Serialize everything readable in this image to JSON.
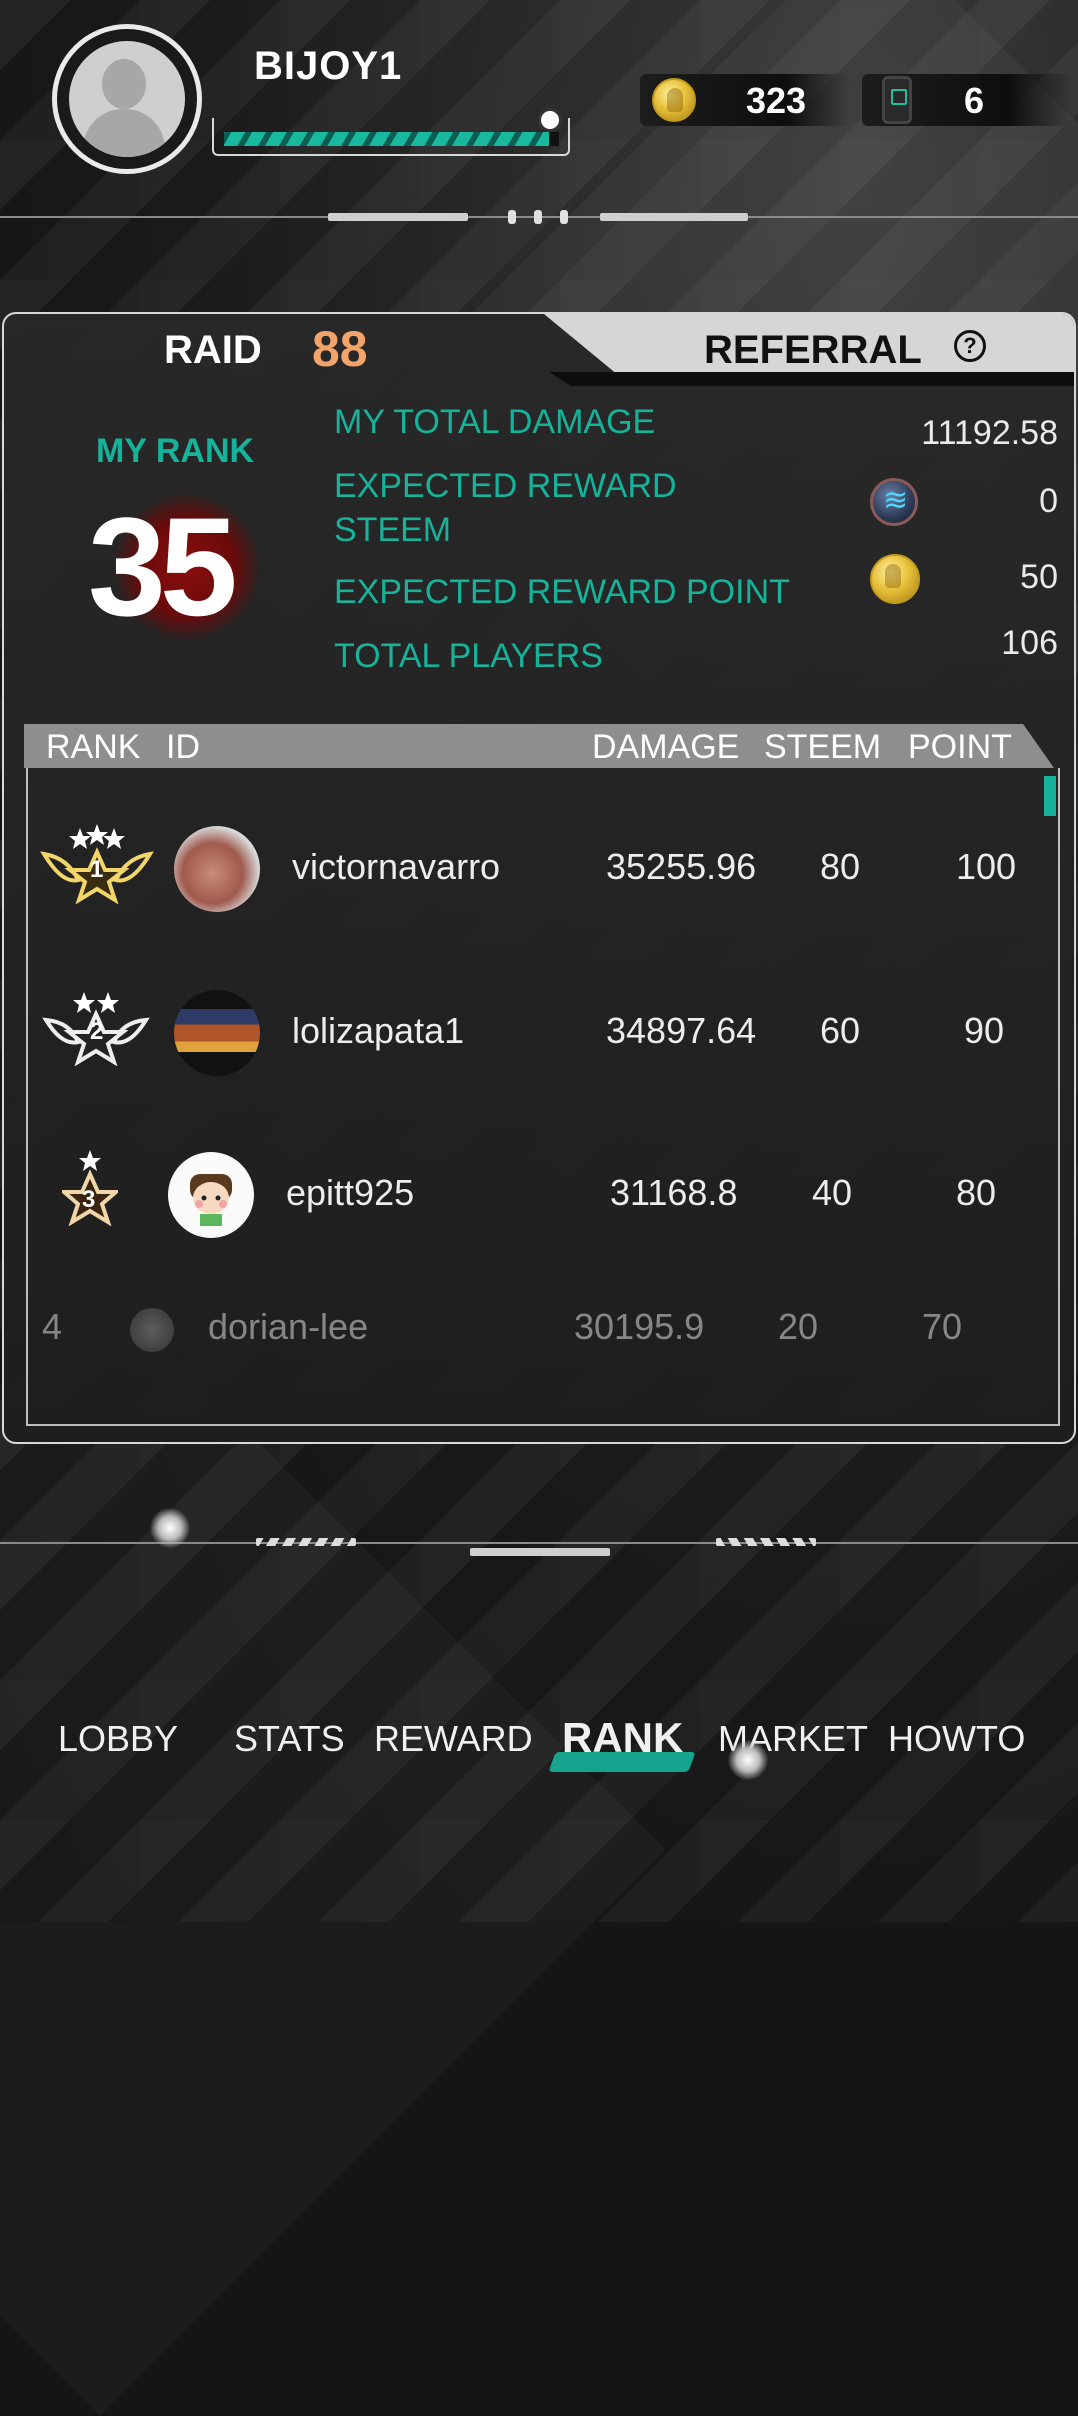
{
  "header": {
    "username": "BIJOY1",
    "xp_fraction": 0.97,
    "coins": "323",
    "items": "6"
  },
  "tabs": {
    "raid_label": "RAID",
    "raid_number": "88",
    "referral_label": "REFERRAL",
    "help": "?"
  },
  "summary": {
    "my_rank_label": "MY RANK",
    "my_rank": "35",
    "total_damage_label": "MY TOTAL DAMAGE",
    "total_damage": "11192.58",
    "expected_steem_label_line1": "EXPECTED REWARD",
    "expected_steem_label_line2": "STEEM",
    "expected_steem": "0",
    "expected_point_label": "EXPECTED REWARD POINT",
    "expected_point": "50",
    "total_players_label": "TOTAL PLAYERS",
    "total_players": "106"
  },
  "table": {
    "columns": [
      "RANK",
      "ID",
      "DAMAGE",
      "STEEM",
      "POINT"
    ],
    "rows": [
      {
        "rank": "1",
        "id": "victornavarro",
        "damage": "35255.96",
        "steem": "80",
        "point": "100"
      },
      {
        "rank": "2",
        "id": "lolizapata1",
        "damage": "34897.64",
        "steem": "60",
        "point": "90"
      },
      {
        "rank": "3",
        "id": "epitt925",
        "damage": "31168.8",
        "steem": "40",
        "point": "80"
      },
      {
        "rank": "4",
        "id": "dorian-lee",
        "damage": "30195.9",
        "steem": "20",
        "point": "70"
      }
    ]
  },
  "nav": {
    "lobby": "LOBBY",
    "stats": "STATS",
    "reward": "REWARD",
    "rank": "RANK",
    "market": "MARKET",
    "howto": "HOWTO"
  },
  "colors": {
    "accent": "#16b39a",
    "raid_number": "#f2a46a",
    "gold": "#e7c03a"
  }
}
